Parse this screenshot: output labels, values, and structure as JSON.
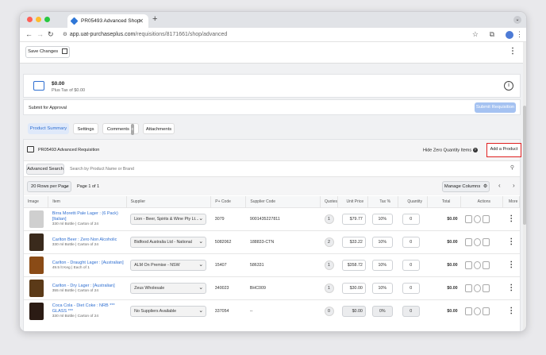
{
  "browser": {
    "tab_title": "PR05493 Advanced Shop",
    "url_domain": "app.uat-purchaseplus.com",
    "url_path": "/requisitions/8171661/shop/advanced",
    "close_glyph": "✕",
    "newtab_glyph": "+"
  },
  "toolbar": {
    "save_label": "Save Changes"
  },
  "summary": {
    "amount": "$0.00",
    "tax": "Plus Tax of $0.00",
    "submit_for_approval": "Submit for Approval",
    "submit_button": "Submit Requisition"
  },
  "tabs": [
    {
      "label": "Product Summary"
    },
    {
      "label": "Settings"
    },
    {
      "label": "Comments",
      "badge": "0"
    },
    {
      "label": "Attachments"
    }
  ],
  "requisition": {
    "title": "PR05493 Advanced Requisition",
    "hide_zero": "Hide Zero Quantity Items",
    "add_product": "Add a Product"
  },
  "search": {
    "advanced": "Advanced Search",
    "placeholder": "Search by Product Name or Brand"
  },
  "pager": {
    "rows_per_page": "20 Rows per Page",
    "page_info": "Page 1 of 1",
    "manage_columns": "Manage Columns"
  },
  "columns": [
    "Image",
    "Item",
    "Supplier",
    "P+ Code",
    "Supplier Code",
    "Quotes",
    "Unit Price",
    "Tax %",
    "Quantity",
    "Total",
    "Actions",
    "More"
  ],
  "rows": [
    {
      "name": "Birra Moretti Pale Lager : (6 Pack) [Italian]",
      "sub": "330 ml Bottle | Carton of 24",
      "supplier": "Lion - Beer, Spirits & Wine Pty Lt...",
      "pcode": "3079",
      "scode": "9001435227811",
      "quotes": "1",
      "price": "$79.77",
      "tax": "10%",
      "qty": "0",
      "total": "$0.00",
      "img": "#cfcfcf"
    },
    {
      "name": "Carlton Beer : Zero Non Alcoholic",
      "sub": "330 ml Bottle | Carton of 24",
      "supplier": "Bidfood Australia Ltd - National",
      "pcode": "5082062",
      "scode": "188833-CTN",
      "quotes": "2",
      "price": "$33.22",
      "tax": "10%",
      "qty": "0",
      "total": "$0.00",
      "img": "#3a2a1c"
    },
    {
      "name": "Carlton - Draught Lager : [Australian]",
      "sub": "49.5 lt Keg | Each of 1",
      "supplier": "ALM On Premise - NSW",
      "pcode": "15407",
      "scode": "586331",
      "quotes": "1",
      "price": "$358.72",
      "tax": "10%",
      "qty": "0",
      "total": "$0.00",
      "img": "#8a4b16"
    },
    {
      "name": "Carlton - Dry Lager : [Australian]",
      "sub": "355 ml Bottle | Carton of 24",
      "supplier": "Zeus Wholesale",
      "pcode": "340023",
      "scode": "BHC009",
      "quotes": "1",
      "price": "$30.00",
      "tax": "10%",
      "qty": "0",
      "total": "$0.00",
      "img": "#5b3a18"
    },
    {
      "name": "Coca Cola - Diet Coke : NRB *** GLASS ***",
      "sub": "330 ml Bottle | Carton of 24",
      "supplier": "No Suppliers Available",
      "pcode": "337054",
      "scode": "--",
      "quotes": "0",
      "price": "$0.00",
      "tax": "0%",
      "qty": "0",
      "total": "$0.00",
      "img": "#2b1b14"
    }
  ],
  "colors": {
    "accent": "#2f6fd1",
    "highlight": "#e02020",
    "disabled_button": "#a5c2f1"
  }
}
